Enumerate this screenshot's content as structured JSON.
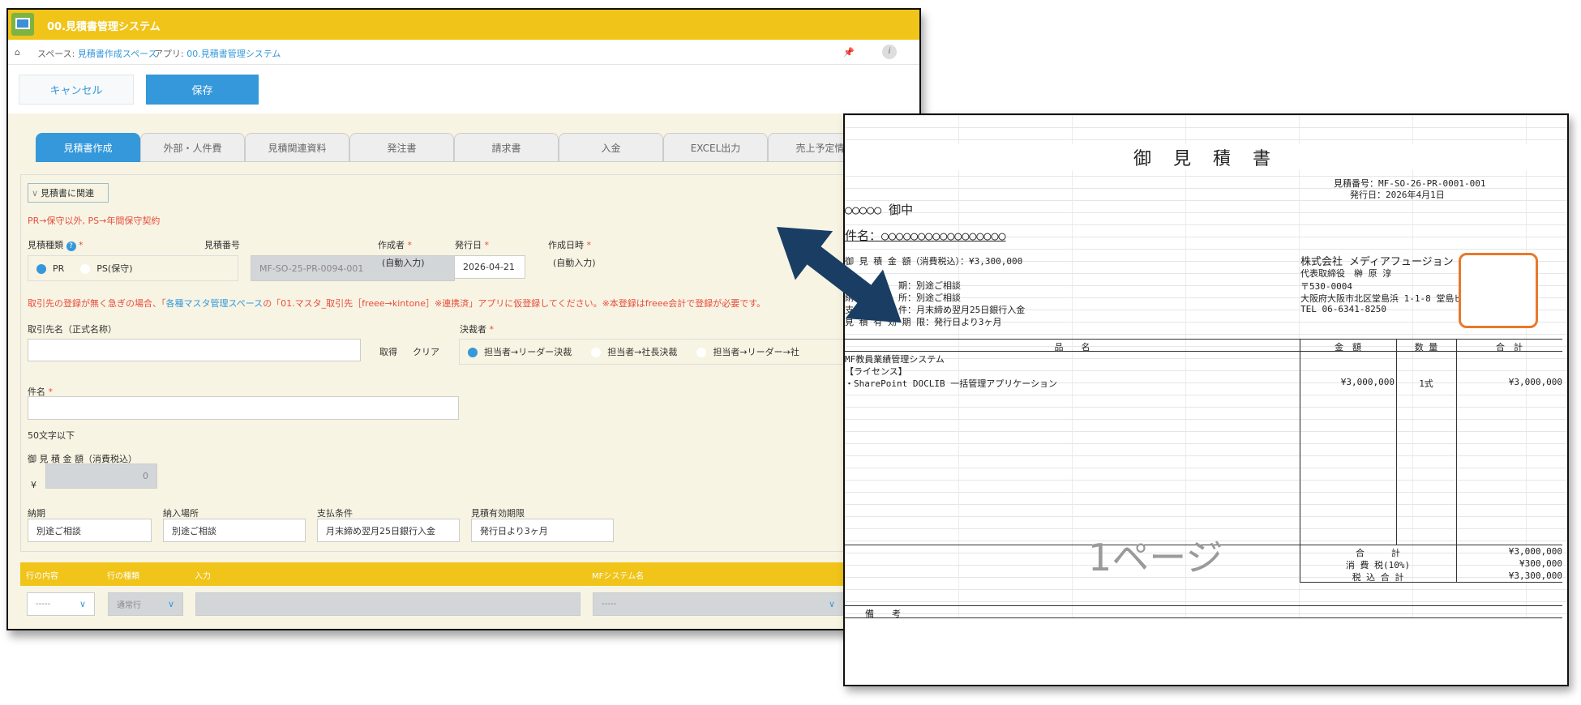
{
  "app": {
    "title": "00.見積書管理システム",
    "breadcrumb": {
      "space_prefix": "スペース: ",
      "space": "見積書作成スペース",
      "app_prefix": "アプリ: ",
      "app": "00.見積書管理システム"
    },
    "buttons": {
      "cancel": "キャンセル",
      "save": "保存"
    },
    "tabs": [
      "見積書作成",
      "外部・人件費",
      "見積関連資料",
      "発注書",
      "請求書",
      "入金",
      "EXCEL出力",
      "売上予定情"
    ],
    "section_toggle": "見積書に関連",
    "note_type": "PR→保守以外, PS→年間保守契約",
    "fields": {
      "type_label": "見積種類",
      "type_options": [
        "PR",
        "PS(保守)"
      ],
      "type_selected": "PR",
      "number_label": "見積番号",
      "number_value": "MF-SO-25-PR-0094-001",
      "author_label": "作成者",
      "author_value": "(自動入力)",
      "issue_label": "発行日",
      "issue_value": "2026-04-21",
      "created_label": "作成日時",
      "created_value": "(自動入力)",
      "client_note_a": "取引先の登録が無く急ぎの場合、「",
      "client_note_link": "各種マスタ管理スペース",
      "client_note_b": "の「01.マスタ_取引先［freee→kintone］※連携済」アプリに仮登録してください。※本登録はfreee会計で登録が必要です。",
      "client_label": "取引先名（正式名称）",
      "client_value": "",
      "get": "取得",
      "clear": "クリア",
      "approver_label": "決裁者",
      "approver_options": [
        "担当者→リーダー決裁",
        "担当者→社長決裁",
        "担当者→リーダー→社"
      ],
      "subject_label": "件名",
      "subject_value": "",
      "subject_hint": "50文字以下",
      "amount_label": "御 見 積 金 額（消費税込）",
      "amount_currency": "¥",
      "amount_value": "0",
      "delivery_label": "納期",
      "delivery_value": "別途ご相談",
      "place_label": "納入場所",
      "place_value": "別途ご相談",
      "payment_label": "支払条件",
      "payment_value": "月末締め翌月25日銀行入金",
      "validity_label": "見積有効期限",
      "validity_value": "発行日より3ヶ月"
    },
    "table": {
      "headers": [
        "行の内容",
        "行の種類",
        "入力",
        "MFシステム名"
      ],
      "row": {
        "content": "-----",
        "kind": "通常行",
        "input": "",
        "system": "-----"
      }
    }
  },
  "document": {
    "title": "御 見 積 書",
    "number": "見積番号：MF-SO-26-PR-0001-001",
    "date": "発行日：2026年4月1日",
    "recipient": "○○○○○ 御中",
    "subject": "件名：○○○○○○○○○○○○○○○○○",
    "amount": "御 見 積 金 額（消費税込）：¥3,300,000",
    "terms": [
      "納　　　　　期：別途ご相談",
      "納　入　場　所：別途ご相談",
      "支　払　条　件：月末締め翌月25日銀行入金",
      "見 積 有 効 期 限：発行日より3ヶ月"
    ],
    "company": [
      "株式会社 メディアフュージョン",
      "代表取締役　榊 原 淳",
      "〒530-0004",
      "大阪府大阪市北区堂島浜 1-1-8 堂島ビル",
      "TEL 06-6341-8250"
    ],
    "stamp": "株式会社メディアフュージョン",
    "headers": [
      "品　　名",
      "金　額",
      "数 量",
      "合　計"
    ],
    "items": [
      {
        "name": "MF教員業績管理システム",
        "price": "",
        "qty": "",
        "total": ""
      },
      {
        "name": "【ライセンス】",
        "price": "",
        "qty": "",
        "total": ""
      },
      {
        "name": "・SharePoint DOCLIB 一括管理アプリケーション",
        "price": "¥3,000,000",
        "qty": "1式",
        "total": "¥3,000,000"
      }
    ],
    "totals": [
      {
        "label": "合　　　計",
        "value": "¥3,000,000"
      },
      {
        "label": "消 費 税(10%)",
        "value": "¥300,000"
      },
      {
        "label": "税 込 合 計",
        "value": "¥3,300,000"
      }
    ],
    "watermark": "1ページ",
    "remarks": "備　　考"
  },
  "colors": {
    "header": "#f0c419",
    "accent": "#3498db",
    "required": "#e74c3c",
    "arrow": "#1a3e63",
    "stamp": "#e8792b"
  }
}
